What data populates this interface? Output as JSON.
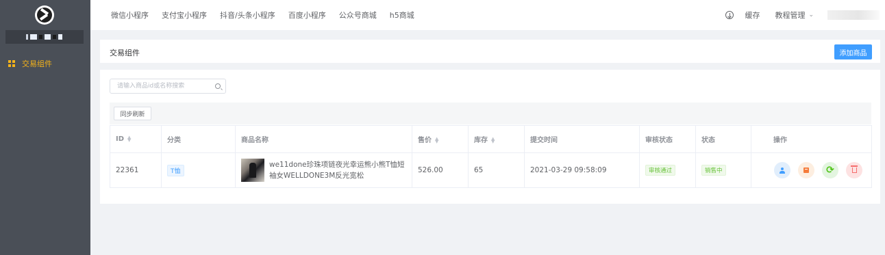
{
  "sidebar": {
    "logo": "brand-logo",
    "shop_name": "",
    "menu": [
      {
        "label": "交易组件",
        "icon": "grid-icon",
        "active": true
      }
    ],
    "active_color": "#f5b31a"
  },
  "topbar": {
    "nav": [
      "微信小程序",
      "支付宝小程序",
      "抖音/头条小程序",
      "百度小程序",
      "公众号商城",
      "h5商城"
    ],
    "cache_label": "缓存",
    "tutorial_label": "教程管理",
    "user": ""
  },
  "header": {
    "title": "交易组件",
    "add_button": "添加商品"
  },
  "search": {
    "placeholder": "请输入商品id或名称搜索"
  },
  "toolbar": {
    "sync_button": "同步刷新"
  },
  "table": {
    "columns": [
      "ID",
      "分类",
      "商品名称",
      "售价",
      "库存",
      "提交时间",
      "审核状态",
      "状态",
      "操作"
    ],
    "rows": [
      {
        "id": "22361",
        "category": "T恤",
        "name": "we11done珍珠项链夜光幸运熊小熊T恤短袖女WELLDONE3M反光宽松",
        "price": "526.00",
        "stock": "65",
        "submit_time": "2021-03-29 09:58:09",
        "audit_status": "审核通过",
        "status": "销售中"
      }
    ]
  },
  "colors": {
    "primary": "#409eff",
    "success": "#67c23a",
    "sidebar_bg": "#4a4f57"
  },
  "action_icons": [
    "user-icon",
    "box-icon",
    "refresh-icon",
    "trash-icon"
  ]
}
